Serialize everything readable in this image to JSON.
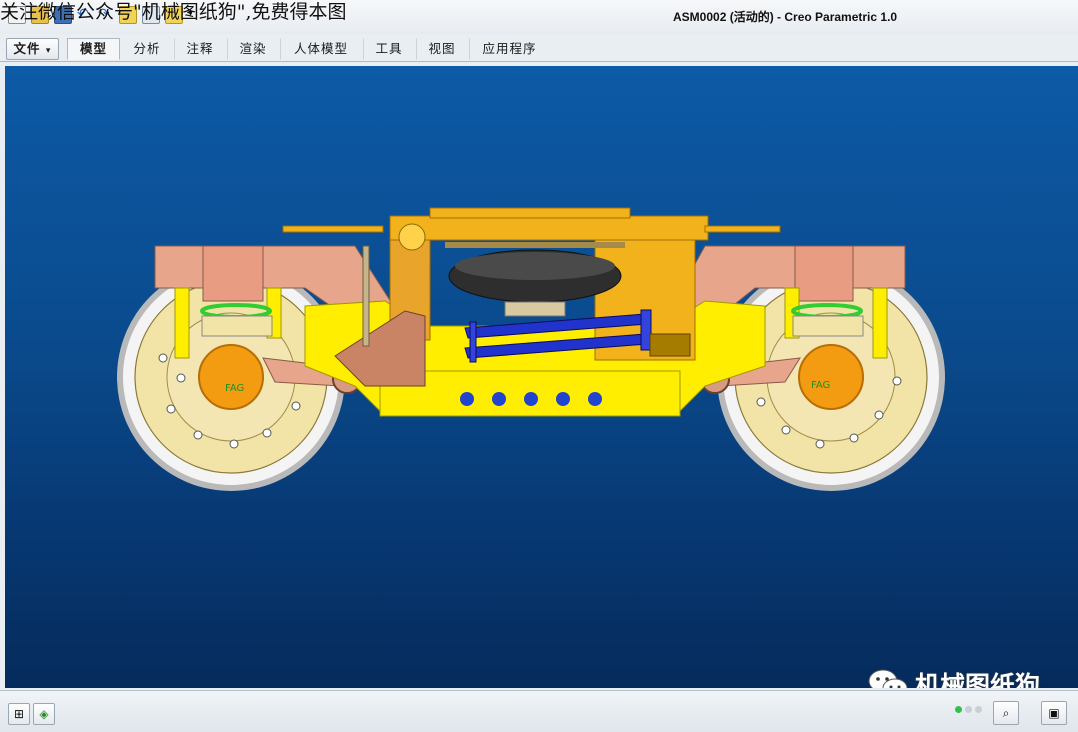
{
  "overlay_note": "关注微信公众号\"机械图纸狗\",免费得本图",
  "window": {
    "title": "ASM0002 (活动的) - Creo Parametric 1.0"
  },
  "quick_access": [
    "new-icon",
    "open-icon",
    "save-icon",
    "undo-icon",
    "redo-icon",
    "regenerate-icon",
    "window-icon",
    "close-window-icon",
    "customize-icon"
  ],
  "tabs": [
    {
      "label": "文件",
      "type": "file"
    },
    {
      "label": "模型",
      "active": true
    },
    {
      "label": "分析"
    },
    {
      "label": "注释"
    },
    {
      "label": "渲染"
    },
    {
      "label": "人体模型"
    },
    {
      "label": "工具"
    },
    {
      "label": "视图"
    },
    {
      "label": "应用程序"
    }
  ],
  "file_arrow": "▾",
  "viewport": {
    "background_top": "#0d5aa6",
    "background_bottom": "#052b5c",
    "model_description_colors": {
      "frame": "#e7a58c",
      "bolster": "#f2b21b",
      "yellow": "#ffee00",
      "wheel": "#f2e3a6",
      "damper": "#2233cc",
      "spring": "#33cc33",
      "airbag": "#2e2e2e"
    },
    "axlebox_label": "FAG"
  },
  "watermark": {
    "text": "机械图纸狗"
  },
  "statusbar": {
    "left_icons": [
      "model-tree-icon",
      "layer-icon"
    ],
    "right_icons": [
      "find-icon",
      "view-cube-icon"
    ]
  }
}
